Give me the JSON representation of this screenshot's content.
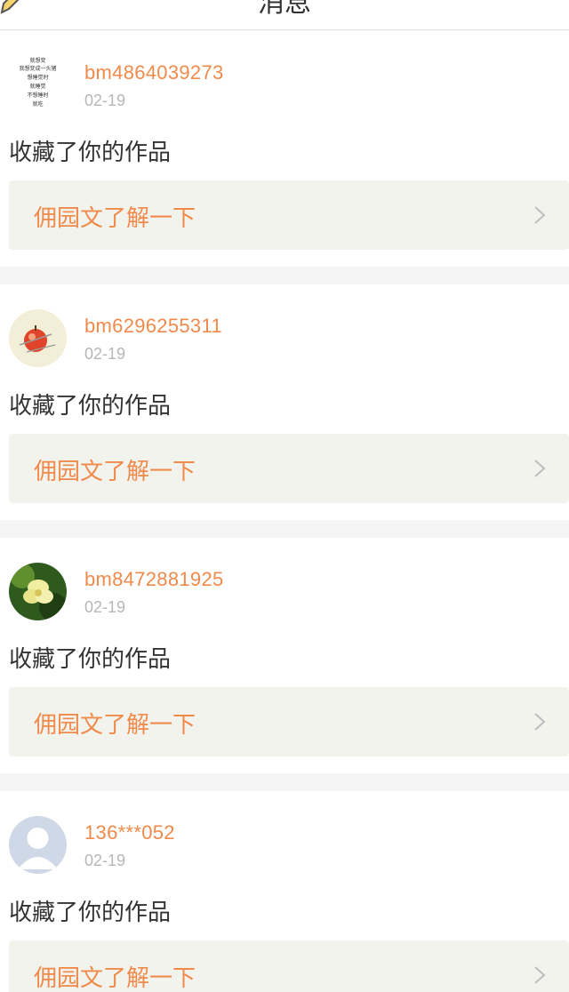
{
  "header": {
    "title": "消息"
  },
  "messages": [
    {
      "username": "bm4864039273",
      "date": "02-19",
      "action": "收藏了你的作品",
      "link_label": "佣园文了解一下",
      "avatar": "text-avatar",
      "avatar_lines": [
        "就想变",
        "我想变成一头猪",
        "想睡觉时",
        "就睡觉",
        "不想睡时",
        "就吃"
      ]
    },
    {
      "username": "bm6296255311",
      "date": "02-19",
      "action": "收藏了你的作品",
      "link_label": "佣园文了解一下",
      "avatar": "apple-avatar"
    },
    {
      "username": "bm8472881925",
      "date": "02-19",
      "action": "收藏了你的作品",
      "link_label": "佣园文了解一下",
      "avatar": "flower-avatar"
    },
    {
      "username": "136***052",
      "date": "02-19",
      "action": "收藏了你的作品",
      "link_label": "佣园文了解一下",
      "avatar": "default-user-avatar"
    }
  ],
  "colors": {
    "accent": "#f08a4b",
    "secondary_text": "#b7b7b7",
    "link_box_bg": "#f3f3ee",
    "page_bg": "#f5f5f5"
  }
}
